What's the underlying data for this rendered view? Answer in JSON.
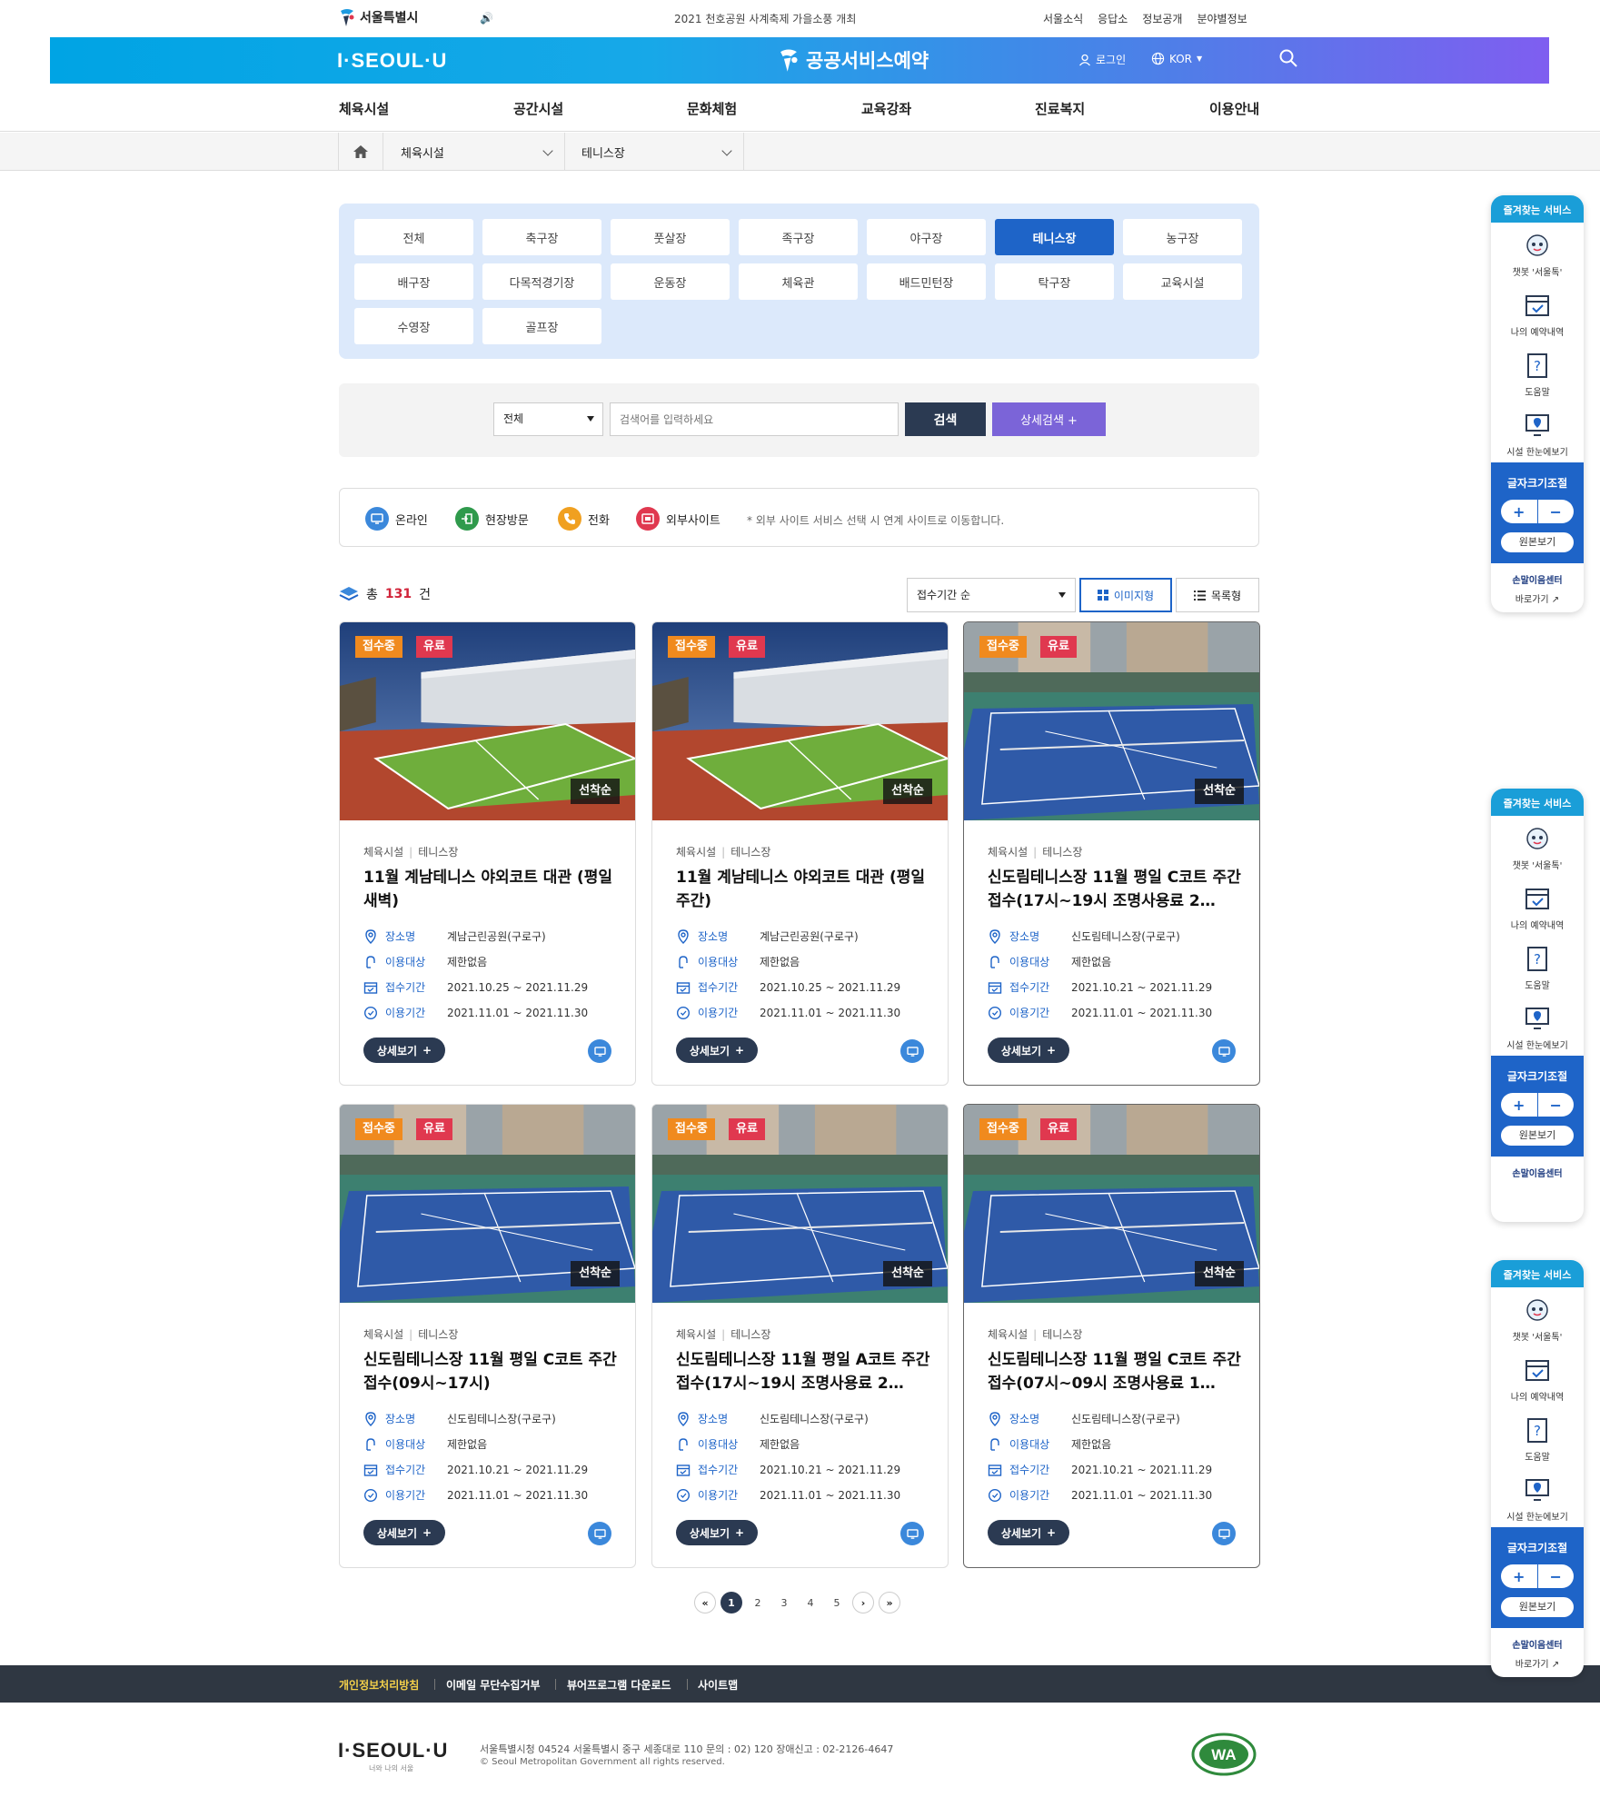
{
  "topbar": {
    "logo": "서울특별시",
    "notice": "2021 천호공원 사계축제 가을소풍 개최",
    "links": [
      "서울소식",
      "응답소",
      "정보공개",
      "분야별정보"
    ]
  },
  "banner": {
    "brand": "I·SEOUL·U",
    "title": "공공서비스예약",
    "login": "로그인",
    "lang": "KOR"
  },
  "mainnav": [
    "체육시설",
    "공간시설",
    "문화체험",
    "교육강좌",
    "진료복지",
    "이용안내"
  ],
  "breadcrumb": {
    "sel1": "체육시설",
    "sel2": "테니스장"
  },
  "categories": [
    "전체",
    "축구장",
    "풋살장",
    "족구장",
    "야구장",
    "테니스장",
    "농구장",
    "배구장",
    "다목적경기장",
    "운동장",
    "체육관",
    "배드민턴장",
    "탁구장",
    "교육시설",
    "수영장",
    "골프장"
  ],
  "active_category": "테니스장",
  "search": {
    "select": "전체",
    "placeholder": "검색어를 입력하세요",
    "search_btn": "검색",
    "detail_btn": "상세검색 +"
  },
  "legend": {
    "items": [
      "온라인",
      "현장방문",
      "전화",
      "외부사이트"
    ],
    "note": "* 외부 사이트 서비스 선택 시 연계 사이트로 이동합니다."
  },
  "count": {
    "prefix": "총",
    "num": "131",
    "suffix": "건"
  },
  "sort": {
    "select": "접수기간 순",
    "image_view": "이미지형",
    "list_view": "목록형"
  },
  "card_labels": {
    "place": "장소명",
    "target": "이용대상",
    "apply": "접수기간",
    "use": "이용기간",
    "detail": "상세보기",
    "status": "접수중",
    "fee": "유료",
    "order": "선착순",
    "cat1": "체육시설",
    "cat2": "테니스장"
  },
  "cards": [
    {
      "title": "11월 계남테니스 야외코트 대관 (평일 새벽)",
      "place": "계남근린공원(구로구)",
      "target": "제한없음",
      "apply": "2021.10.25 ~ 2021.11.29",
      "use": "2021.11.01 ~ 2021.11.30"
    },
    {
      "title": "11월 계남테니스 야외코트 대관 (평일주간)",
      "place": "계남근린공원(구로구)",
      "target": "제한없음",
      "apply": "2021.10.25 ~ 2021.11.29",
      "use": "2021.11.01 ~ 2021.11.30"
    },
    {
      "title": "신도림테니스장 11월 평일 C코트 주간 접수(17시~19시 조명사용료 2…",
      "place": "신도림테니스장(구로구)",
      "target": "제한없음",
      "apply": "2021.10.21 ~ 2021.11.29",
      "use": "2021.11.01 ~ 2021.11.30"
    },
    {
      "title": "신도림테니스장 11월 평일 C코트 주간 접수(09시~17시)",
      "place": "신도림테니스장(구로구)",
      "target": "제한없음",
      "apply": "2021.10.21 ~ 2021.11.29",
      "use": "2021.11.01 ~ 2021.11.30"
    },
    {
      "title": "신도림테니스장 11월 평일 A코트 주간 접수(17시~19시 조명사용료 2…",
      "place": "신도림테니스장(구로구)",
      "target": "제한없음",
      "apply": "2021.10.21 ~ 2021.11.29",
      "use": "2021.11.01 ~ 2021.11.30"
    },
    {
      "title": "신도림테니스장 11월 평일 C코트 주간 접수(07시~09시 조명사용료 1…",
      "place": "신도림테니스장(구로구)",
      "target": "제한없음",
      "apply": "2021.10.21 ~ 2021.11.29",
      "use": "2021.11.01 ~ 2021.11.30"
    }
  ],
  "pager": {
    "pages": [
      "1",
      "2",
      "3",
      "4",
      "5"
    ],
    "current": "1"
  },
  "footer": {
    "links": [
      "개인정보처리방침",
      "이메일 무단수집거부",
      "뷰어프로그램 다운로드",
      "사이트맵"
    ],
    "brand": "I·SEOUL·U",
    "brand_sub": "너와 나의 서울",
    "address": "서울특별시청 04524 서울특별시 중구 세종대로 110   문의 : 02) 120    장애신고 : 02-2126-4647",
    "copyright": "© Seoul Metropolitan Government all rights reserved."
  },
  "quick": {
    "head": "즐겨찾는 서비스",
    "items": [
      "챗봇 '서울톡'",
      "나의 예약내역",
      "도움말",
      "시설 한눈에보기"
    ],
    "font_title": "글자크기조절",
    "plus": "+",
    "minus": "−",
    "original": "원본보기",
    "center": "손말이음센터",
    "goto": "바로가기"
  },
  "colors": {
    "accent": "#1e64c8",
    "navy": "#2b3a52",
    "orange": "#f08a1e",
    "red": "#e0384f",
    "purple": "#7b64d8"
  }
}
